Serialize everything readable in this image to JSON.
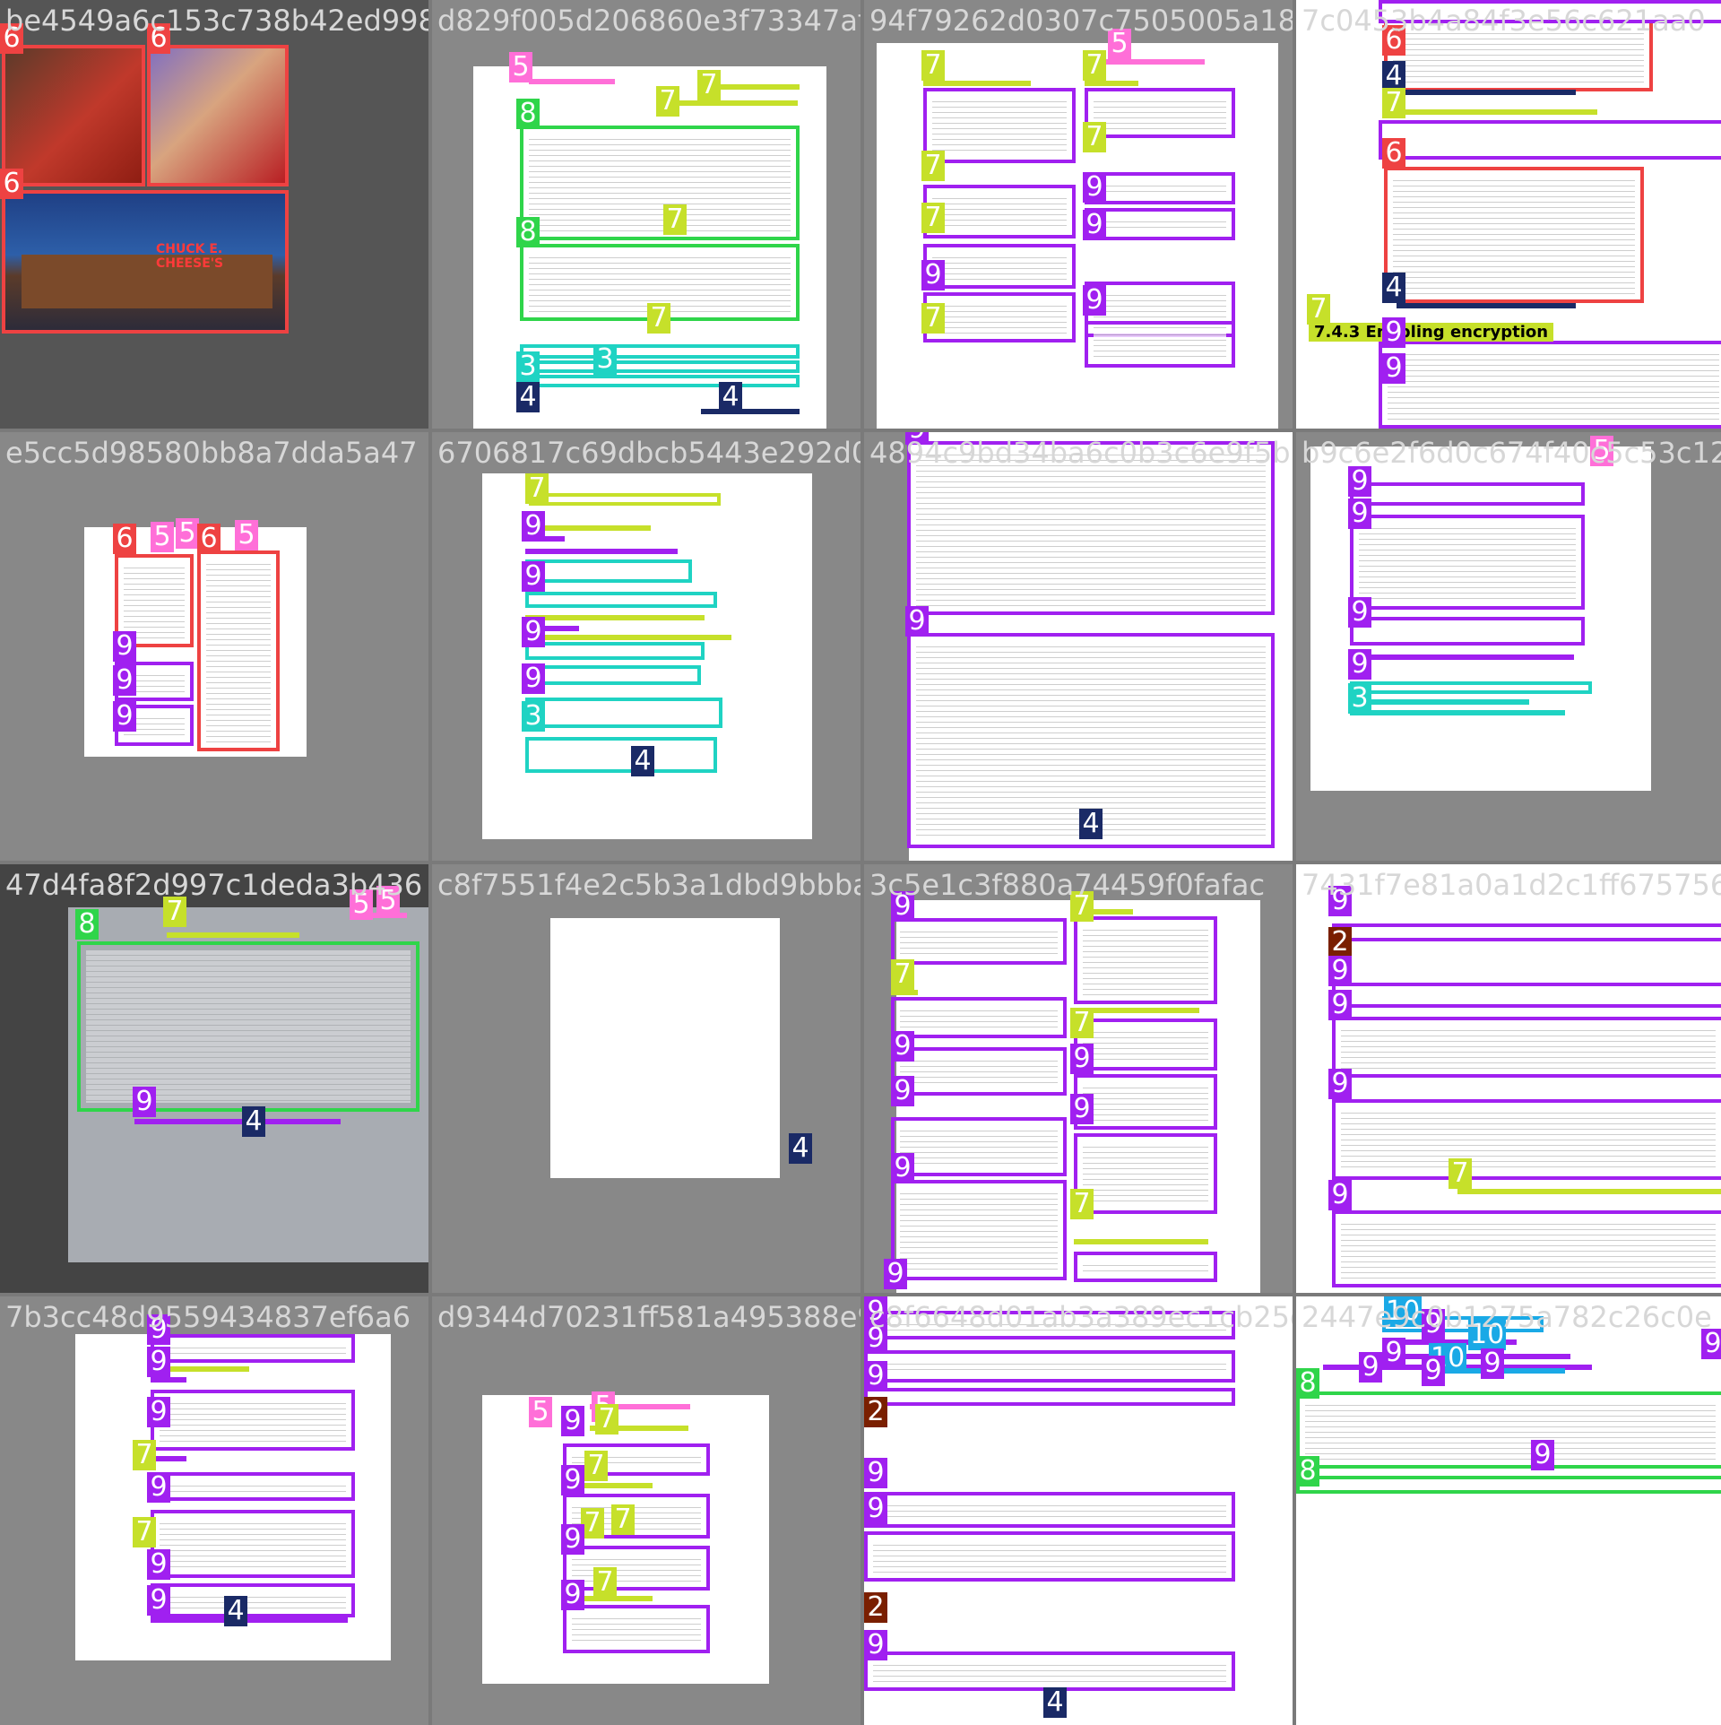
{
  "tiles": [
    {
      "id": "be4549a6c153c738b42ed998"
    },
    {
      "id": "d829f005d206860e3f73347af5"
    },
    {
      "id": "94f79262d0307c7505005a18"
    },
    {
      "id": "7c0453b4a84f3e56c621aa0"
    },
    {
      "id": "e5cc5d98580bb8a7dda5a47"
    },
    {
      "id": "6706817c69dbcb5443e292d079"
    },
    {
      "id": "4894c9bd34ba6c0b3c6e9f5b"
    },
    {
      "id": "b9c6e2f6d0c674f40c5c53c129"
    },
    {
      "id": "47d4fa8f2d997c1deda3b436"
    },
    {
      "id": "c8f7551f4e2c5b3a1dbd9bbba"
    },
    {
      "id": "3c5e1c3f880a74459f0fafac"
    },
    {
      "id": "7431f7e81a0a1d2c1ff675756"
    },
    {
      "id": "7b3cc48d9559434837ef6a6"
    },
    {
      "id": "d9344d70231ff581a495388e90"
    },
    {
      "id": "c8f6648d01ab3a389ec1cb25da"
    },
    {
      "id": "2447e9c0b1275a782c26c0e"
    }
  ],
  "tile1": {
    "sign": "CHUCK E. CHEESE'S"
  },
  "tile4": {
    "heading": "7.4.3  Enabling encryption"
  },
  "labels": {
    "n2": "2",
    "n3": "3",
    "n4": "4",
    "n5": "5",
    "n6": "6",
    "n7": "7",
    "n8": "8",
    "n9": "9",
    "n10": "10"
  },
  "colors": {
    "label2": "#7a1f00",
    "label3": "#1fd3c3",
    "label4": "#1a2a66",
    "label5": "#ff6fd8",
    "label6": "#ee4242",
    "label7": "#c6e02a",
    "label8": "#2fd54a",
    "label9": "#a020f0",
    "label10": "#1aa9e6",
    "tile_background": "#7a7a7a"
  }
}
